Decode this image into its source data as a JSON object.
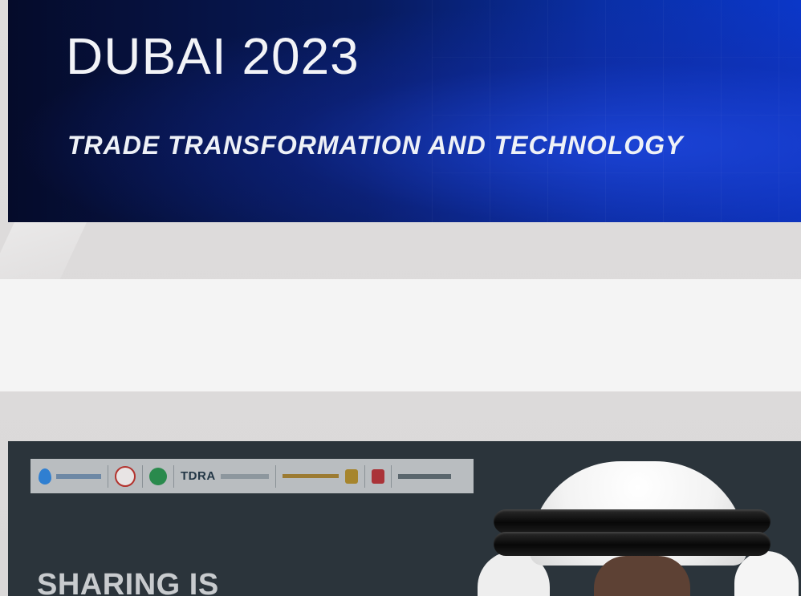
{
  "banner": {
    "title": "DUBAI 2023",
    "subtitle": "TRADE TRANSFORMATION AND TECHNOLOGY"
  },
  "bottom_panel": {
    "headline_partial": "SHARING IS",
    "logos": [
      "blue-drop-logo",
      "red-circle-logo",
      "green-emblem-logo",
      "tdra-logo",
      "gold-cyber-security-logo",
      "uae-emblem-logo",
      "central-bank-logo"
    ],
    "tdra_text": "TDRA"
  },
  "colors": {
    "banner_dark": "#050b2a",
    "banner_blue": "#0b37c8",
    "panel_background": "#2b343b",
    "logo_bar": "#b9bdc0",
    "light_strip": "#f4f4f4"
  }
}
